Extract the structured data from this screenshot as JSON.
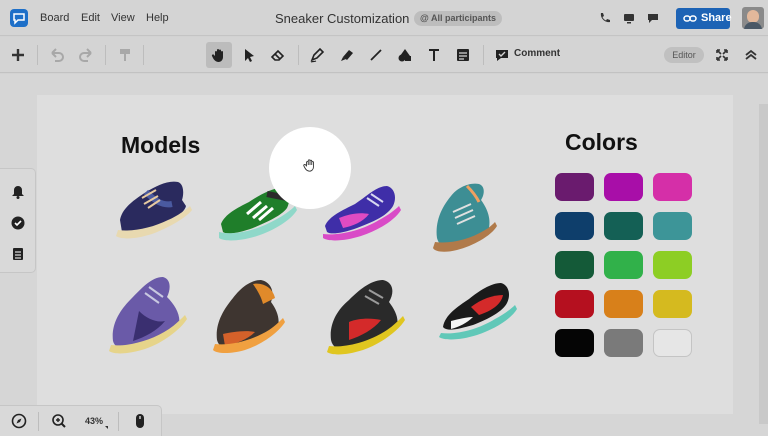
{
  "menu": {
    "items": [
      "Board",
      "Edit",
      "View",
      "Help"
    ],
    "board_title": "Sneaker Customization",
    "participants_label": "All participants"
  },
  "header": {
    "share_label": "Share",
    "icons": [
      "phone-icon",
      "screen-share-icon",
      "chat-icon"
    ]
  },
  "toolbar": {
    "tools": [
      "add-icon",
      "undo-icon",
      "redo-icon",
      "format-painter-icon",
      "hand-icon",
      "select-icon",
      "eraser-icon",
      "pen-icon",
      "highlighter-icon",
      "line-icon",
      "shapes-icon",
      "text-icon",
      "sticky-note-icon",
      "comment-icon"
    ],
    "active_tool": "hand-icon",
    "comment_label": "Comment",
    "role_badge": "Editor"
  },
  "canvas": {
    "models_title": "Models",
    "colors_title": "Colors",
    "models": [
      "navy sneaker with beige sole",
      "green sneaker with white stripes",
      "purple and pink sneaker",
      "teal high-top sneaker",
      "lavender sneaker with yellow sole",
      "brown and orange high-top",
      "black and yellow sneaker",
      "black red and white sneaker"
    ],
    "colors": [
      "#6a1b6e",
      "#a80ea8",
      "#d52fa8",
      "#0e3e6b",
      "#146055",
      "#3d9598",
      "#145a38",
      "#31b14a",
      "#8dce24",
      "#b5101f",
      "#d8801a",
      "#d5ba1f",
      "#050505",
      "#7a7a7a",
      "#e6e6e6"
    ]
  },
  "sidebar": {
    "icons": [
      "notification-bell-icon",
      "checkmark-icon",
      "list-icon"
    ]
  },
  "bottombar": {
    "icons": [
      "compass-icon",
      "zoom-in-icon",
      "mouse-icon"
    ],
    "zoom_level": "43%"
  }
}
